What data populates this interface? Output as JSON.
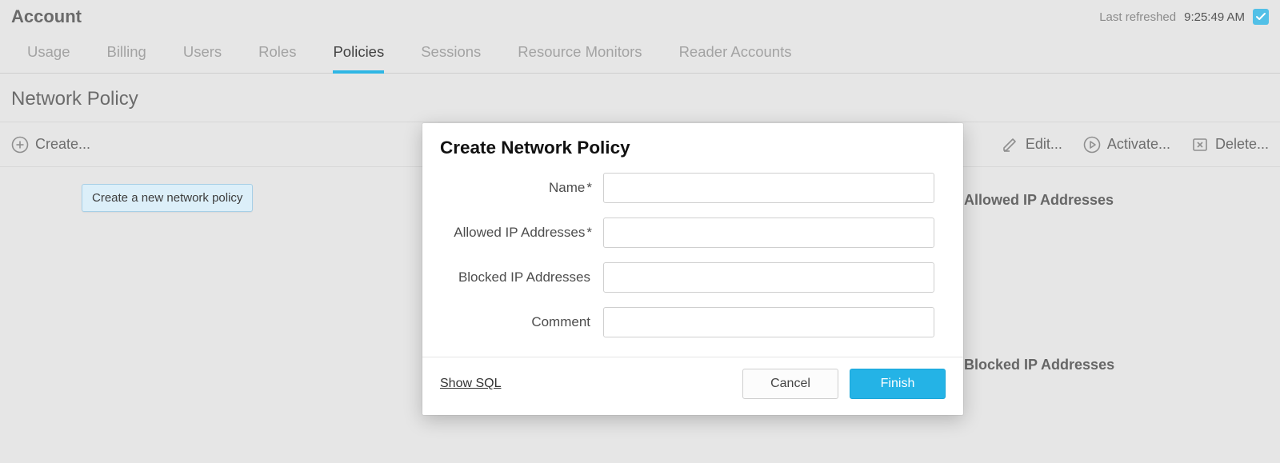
{
  "header": {
    "title": "Account",
    "refresh_label": "Last refreshed",
    "refresh_time": "9:25:49 AM"
  },
  "tabs": [
    {
      "label": "Usage",
      "active": false
    },
    {
      "label": "Billing",
      "active": false
    },
    {
      "label": "Users",
      "active": false
    },
    {
      "label": "Roles",
      "active": false
    },
    {
      "label": "Policies",
      "active": true
    },
    {
      "label": "Sessions",
      "active": false
    },
    {
      "label": "Resource Monitors",
      "active": false
    },
    {
      "label": "Reader Accounts",
      "active": false
    }
  ],
  "subheader": {
    "title": "Network Policy"
  },
  "actions": {
    "create": "Create...",
    "edit": "Edit...",
    "activate": "Activate...",
    "delete": "Delete..."
  },
  "tooltip": {
    "text": "Create a new network policy"
  },
  "side_panels": {
    "allowed": "Allowed IP Addresses",
    "blocked": "Blocked IP Addresses"
  },
  "dialog": {
    "title": "Create Network Policy",
    "fields": {
      "name": {
        "label": "Name",
        "required": "*",
        "value": ""
      },
      "allowed": {
        "label": "Allowed IP Addresses",
        "required": "*",
        "value": ""
      },
      "blocked": {
        "label": "Blocked IP Addresses",
        "required": "",
        "value": ""
      },
      "comment": {
        "label": "Comment",
        "required": "",
        "value": ""
      }
    },
    "show_sql": "Show SQL",
    "cancel": "Cancel",
    "finish": "Finish"
  }
}
